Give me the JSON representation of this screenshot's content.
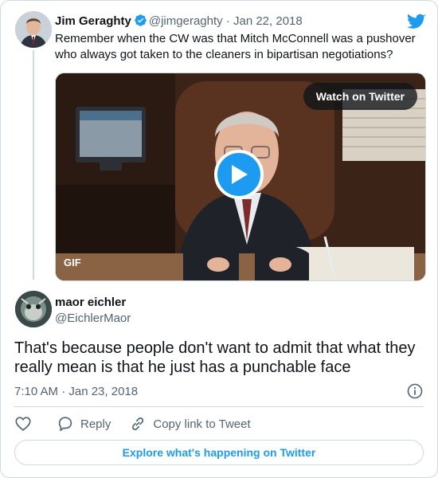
{
  "quoted_tweet": {
    "name": "Jim Geraghty",
    "handle": "@jimgeraghty",
    "separator": "·",
    "date": "Jan 22, 2018",
    "text": "Remember when the CW was that Mitch McConnell was a pushover who always got taken to the cleaners in bipartisan negotiations?",
    "media": {
      "watch_label": "Watch on Twitter",
      "gif_label": "GIF"
    }
  },
  "reply_tweet": {
    "name": "maor eichler",
    "handle": "@EichlerMaor",
    "text": "That's because people don't want to admit that what they really mean is that he just has a punchable face",
    "timestamp": "7:10 AM · Jan 23, 2018"
  },
  "actions": {
    "reply_label": "Reply",
    "copy_link_label": "Copy link to Tweet"
  },
  "explore_label": "Explore what's happening on Twitter",
  "colors": {
    "accent": "#1d9bf0",
    "secondary_text": "#536471",
    "border": "#cfd9de"
  },
  "icons": [
    "verified-badge-icon",
    "twitter-bird-icon",
    "play-icon",
    "info-icon",
    "heart-icon",
    "reply-bubble-icon",
    "link-icon"
  ]
}
